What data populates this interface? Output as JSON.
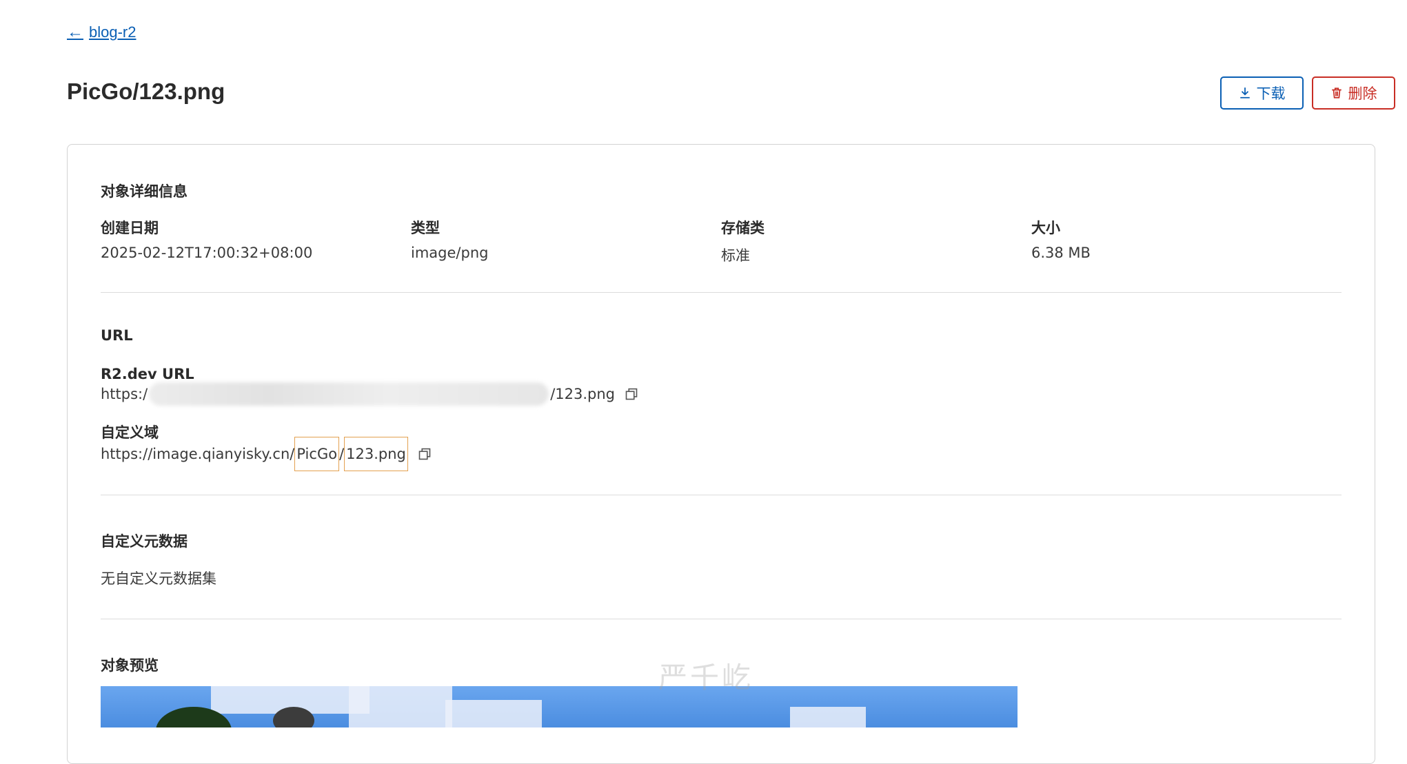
{
  "nav": {
    "back_label": "blog-r2"
  },
  "header": {
    "title": "PicGo/123.png",
    "download_label": "下载",
    "delete_label": "删除"
  },
  "details": {
    "section_title": "对象详细信息",
    "fields": [
      {
        "label": "创建日期",
        "value": "2025-02-12T17:00:32+08:00"
      },
      {
        "label": "类型",
        "value": "image/png"
      },
      {
        "label": "存储类",
        "value": "标准"
      },
      {
        "label": "大小",
        "value": "6.38 MB"
      }
    ]
  },
  "url": {
    "section_title": "URL",
    "r2_label": "R2.dev URL",
    "r2_prefix": "https:/",
    "r2_suffix": "/123.png",
    "custom_label": "自定义域",
    "custom_prefix": "https://image.qianyisky.cn/",
    "custom_folder": "PicGo",
    "custom_sep": "/",
    "custom_file": "123.png"
  },
  "metadata": {
    "section_title": "自定义元数据",
    "empty_text": "无自定义元数据集"
  },
  "preview": {
    "section_title": "对象预览"
  },
  "watermark": "严千屹",
  "colors": {
    "accent": "#0a5fb4",
    "danger": "#c82d24",
    "highlight": "#e3a04f"
  }
}
